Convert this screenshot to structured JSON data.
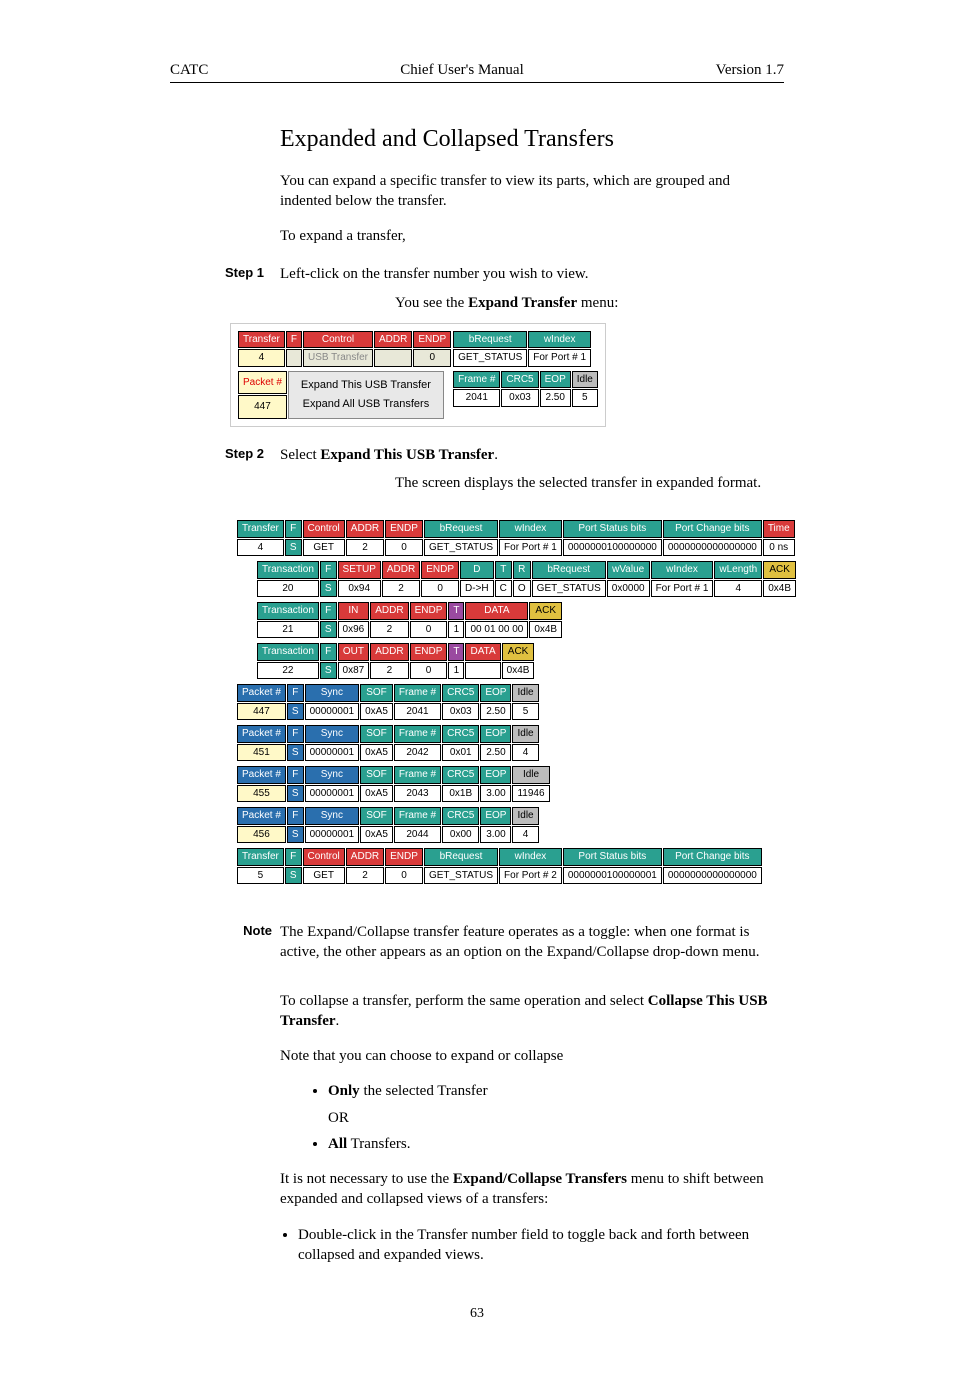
{
  "header": {
    "left": "CATC",
    "center": "Chief User's Manual",
    "right": "Version 1.7"
  },
  "title": "Expanded and Collapsed Transfers",
  "intro": "You can expand a specific transfer to view its parts, which are grouped and indented below the transfer.",
  "toExpand": "To expand a transfer,",
  "step1": {
    "label": "Step 1",
    "text": "Left-click on the transfer number you wish to view."
  },
  "expandMenuLead_a": "You see the ",
  "expandMenuLead_b": "Expand Transfer",
  "expandMenuLead_c": " menu:",
  "fig1": {
    "row1": {
      "transfer_h": "Transfer",
      "transfer_v": "4",
      "f": "F",
      "control": "Control",
      "usb_transfer": "USB Transfer",
      "addr": "ADDR",
      "endp": "ENDP",
      "endp_v": "0",
      "breq_h": "bRequest",
      "breq_v": "GET_STATUS",
      "windex_h": "wIndex",
      "windex_v": "For Port # 1"
    },
    "row2": {
      "packet_h": "Packet #",
      "packet_v": "447",
      "menu_item1": "Expand This USB Transfer",
      "menu_item2": "Expand All USB Transfers",
      "frame_h": "Frame #",
      "frame_v": "2041",
      "crc_h": "CRC5",
      "crc_v": "0x03",
      "eop_h": "EOP",
      "eop_v": "2.50",
      "idle_h": "Idle",
      "idle_v": "5"
    }
  },
  "step2": {
    "label": "Step 2",
    "pre": "Select ",
    "bold": "Expand This USB Transfer",
    "post": "."
  },
  "afterStep2": "The screen displays the selected transfer in expanded format.",
  "fig2": {
    "transfer4": {
      "h": "Transfer",
      "v": "4",
      "f": "F",
      "s": "S",
      "control": "Control",
      "get": "GET",
      "addr_h": "ADDR",
      "addr_v": "2",
      "endp_h": "ENDP",
      "endp_v": "0",
      "breq_h": "bRequest",
      "breq_v": "GET_STATUS",
      "windex_h": "wIndex",
      "windex_v": "For Port # 1",
      "psb_h": "Port Status bits",
      "psb_v": "0000000100000000",
      "pcb_h": "Port Change bits",
      "pcb_v": "0000000000000000",
      "time_h": "Time",
      "time_v": "0 ns"
    },
    "trans20": {
      "h": "Transaction",
      "v": "20",
      "f": "F",
      "s": "S",
      "setup": "SETUP",
      "pid": "0x94",
      "addr_h": "ADDR",
      "addr_v": "2",
      "endp_h": "ENDP",
      "endp_v": "0",
      "d_h": "D",
      "d_v": "D->H",
      "t_h": "T",
      "t_v": "C",
      "r_h": "R",
      "r_v": "O",
      "breq_h": "bRequest",
      "breq_v": "GET_STATUS",
      "wval_h": "wValue",
      "wval_v": "0x0000",
      "windex_h": "wIndex",
      "windex_v": "For Port # 1",
      "wlen_h": "wLength",
      "wlen_v": "4",
      "ack_h": "ACK",
      "ack_v": "0x4B"
    },
    "trans21": {
      "h": "Transaction",
      "v": "21",
      "f": "F",
      "s": "S",
      "in": "IN",
      "pid": "0x96",
      "addr_h": "ADDR",
      "addr_v": "2",
      "endp_h": "ENDP",
      "endp_v": "0",
      "t_h": "T",
      "t_v": "1",
      "data_h": "DATA",
      "data_v": "00 01 00 00",
      "ack_h": "ACK",
      "ack_v": "0x4B"
    },
    "trans22": {
      "h": "Transaction",
      "v": "22",
      "f": "F",
      "s": "S",
      "out": "OUT",
      "pid": "0x87",
      "addr_h": "ADDR",
      "addr_v": "2",
      "endp_h": "ENDP",
      "endp_v": "0",
      "t_h": "T",
      "t_v": "1",
      "data_h": "DATA",
      "ack_h": "ACK",
      "ack_v": "0x4B"
    },
    "packets": [
      {
        "h": "Packet #",
        "v": "447",
        "f": "F",
        "s": "S",
        "sync_h": "Sync",
        "sync_v": "00000001",
        "sof_h": "SOF",
        "sof_v": "0xA5",
        "frame_h": "Frame #",
        "frame_v": "2041",
        "crc_h": "CRC5",
        "crc_v": "0x03",
        "eop_h": "EOP",
        "eop_v": "2.50",
        "idle_h": "Idle",
        "idle_v": "5"
      },
      {
        "h": "Packet #",
        "v": "451",
        "f": "F",
        "s": "S",
        "sync_h": "Sync",
        "sync_v": "00000001",
        "sof_h": "SOF",
        "sof_v": "0xA5",
        "frame_h": "Frame #",
        "frame_v": "2042",
        "crc_h": "CRC5",
        "crc_v": "0x01",
        "eop_h": "EOP",
        "eop_v": "2.50",
        "idle_h": "Idle",
        "idle_v": "4"
      },
      {
        "h": "Packet #",
        "v": "455",
        "f": "F",
        "s": "S",
        "sync_h": "Sync",
        "sync_v": "00000001",
        "sof_h": "SOF",
        "sof_v": "0xA5",
        "frame_h": "Frame #",
        "frame_v": "2043",
        "crc_h": "CRC5",
        "crc_v": "0x1B",
        "eop_h": "EOP",
        "eop_v": "3.00",
        "idle_h": "Idle",
        "idle_v": "11946"
      },
      {
        "h": "Packet #",
        "v": "456",
        "f": "F",
        "s": "S",
        "sync_h": "Sync",
        "sync_v": "00000001",
        "sof_h": "SOF",
        "sof_v": "0xA5",
        "frame_h": "Frame #",
        "frame_v": "2044",
        "crc_h": "CRC5",
        "crc_v": "0x00",
        "eop_h": "EOP",
        "eop_v": "3.00",
        "idle_h": "Idle",
        "idle_v": "4"
      }
    ],
    "transfer5": {
      "h": "Transfer",
      "v": "5",
      "f": "F",
      "s": "S",
      "control": "Control",
      "get": "GET",
      "addr_h": "ADDR",
      "addr_v": "2",
      "endp_h": "ENDP",
      "endp_v": "0",
      "breq_h": "bRequest",
      "breq_v": "GET_STATUS",
      "windex_h": "wIndex",
      "windex_v": "For Port # 2",
      "psb_h": "Port Status bits",
      "psb_v": "0000000100000001",
      "pcb_h": "Port Change bits",
      "pcb_v": "0000000000000000"
    }
  },
  "note": {
    "label": "Note",
    "text": "The Expand/Collapse transfer feature operates as a toggle: when one format is active, the other appears as an option on the Expand/Collapse drop-down menu."
  },
  "collapse": {
    "pre": "To collapse a transfer, perform the same operation and select ",
    "bold": "Collapse This USB Transfer",
    "post": "."
  },
  "chooseLine": "Note that you can choose to expand or collapse",
  "bullet1": {
    "bold": "Only",
    "rest": " the selected Transfer"
  },
  "or": "OR",
  "bullet2": {
    "bold": "All",
    "rest": " Transfers."
  },
  "notNecessary": {
    "pre": "It is not necessary to use the ",
    "bold": "Expand/Collapse Transfers",
    "post": " menu to shift between expanded and collapsed views of a transfers:"
  },
  "dbl": "Double-click in the Transfer number field to toggle back and forth between collapsed and expanded views.",
  "pageNum": "63"
}
